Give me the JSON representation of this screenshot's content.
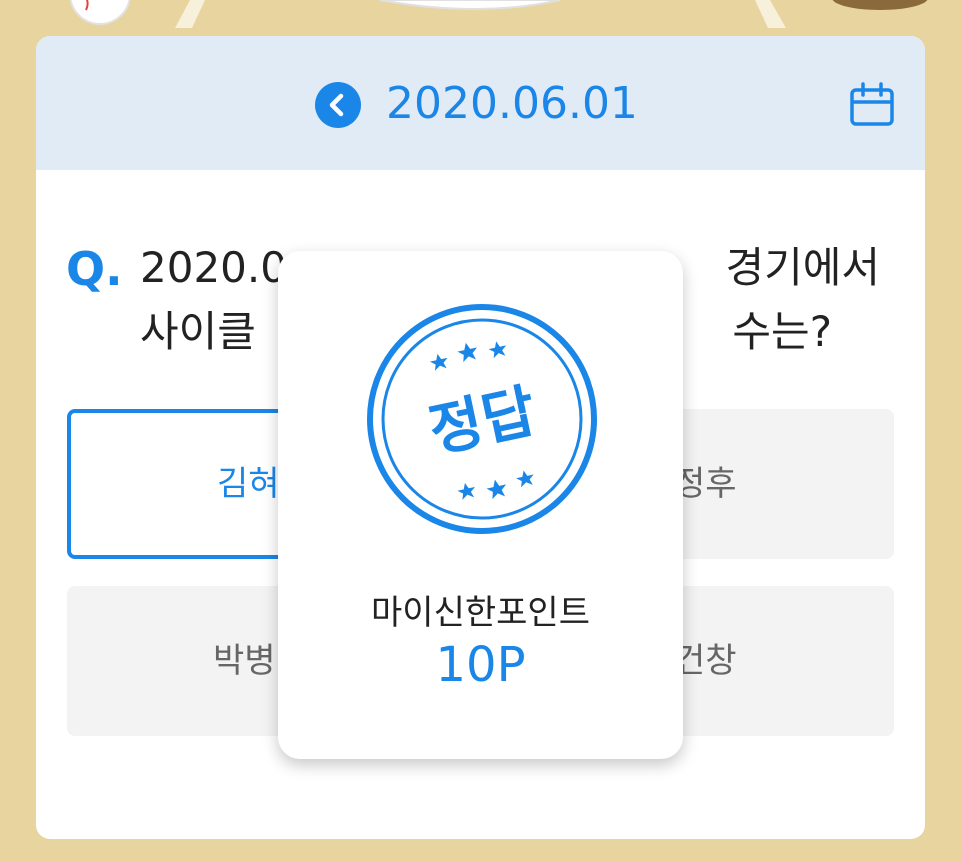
{
  "header": {
    "date": "2020.06.01",
    "back_icon": "chevron-left-circle-icon",
    "calendar_icon": "calendar-icon"
  },
  "question": {
    "prefix": "Q.",
    "line1_visible_left": "2020.0",
    "line1_visible_right": "경기에서",
    "line2_visible_left": "사이클",
    "line2_visible_right": "수는?"
  },
  "answers": [
    {
      "visible_left": "김혀",
      "visible_right": "",
      "selected": true
    },
    {
      "visible_left": "",
      "visible_right": "정후",
      "selected": false
    },
    {
      "visible_left": "박병",
      "visible_right": "",
      "selected": false
    },
    {
      "visible_left": "",
      "visible_right": "건창",
      "selected": false
    }
  ],
  "result_modal": {
    "stamp_text": "정답",
    "reward_title": "마이신한포인트",
    "reward_points": "10P"
  },
  "colors": {
    "accent": "#1a86e8",
    "background": "#e7d49f",
    "header_bg": "#e1ebf5",
    "answer_bg": "#f3f3f3"
  }
}
